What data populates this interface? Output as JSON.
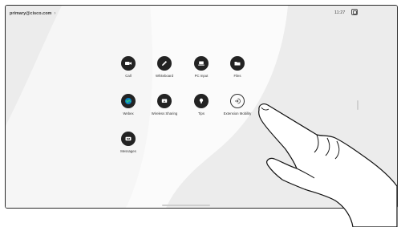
{
  "status_bar": {
    "account": "primary@cisco.com",
    "chevron": "›",
    "time": "11:27",
    "system_icon": "screen-share-icon"
  },
  "apps": [
    {
      "label": "Call",
      "icon": "video-camera-icon"
    },
    {
      "label": "Whiteboard",
      "icon": "pencil-icon"
    },
    {
      "label": "PC Input",
      "icon": "laptop-icon"
    },
    {
      "label": "Files",
      "icon": "folder-icon"
    },
    {
      "label": "Webex",
      "icon": "webex-logo-icon"
    },
    {
      "label": "Wireless Sharing",
      "icon": "wireless-share-icon"
    },
    {
      "label": "Tips",
      "icon": "lightbulb-icon"
    },
    {
      "label": "Extension Mobility",
      "icon": "sign-in-arrow-icon"
    },
    {
      "label": "Messages",
      "icon": "voicemail-icon"
    }
  ],
  "colors": {
    "icon_circle": "#232323",
    "background": "#ededed",
    "highlight": "#ffffff"
  }
}
